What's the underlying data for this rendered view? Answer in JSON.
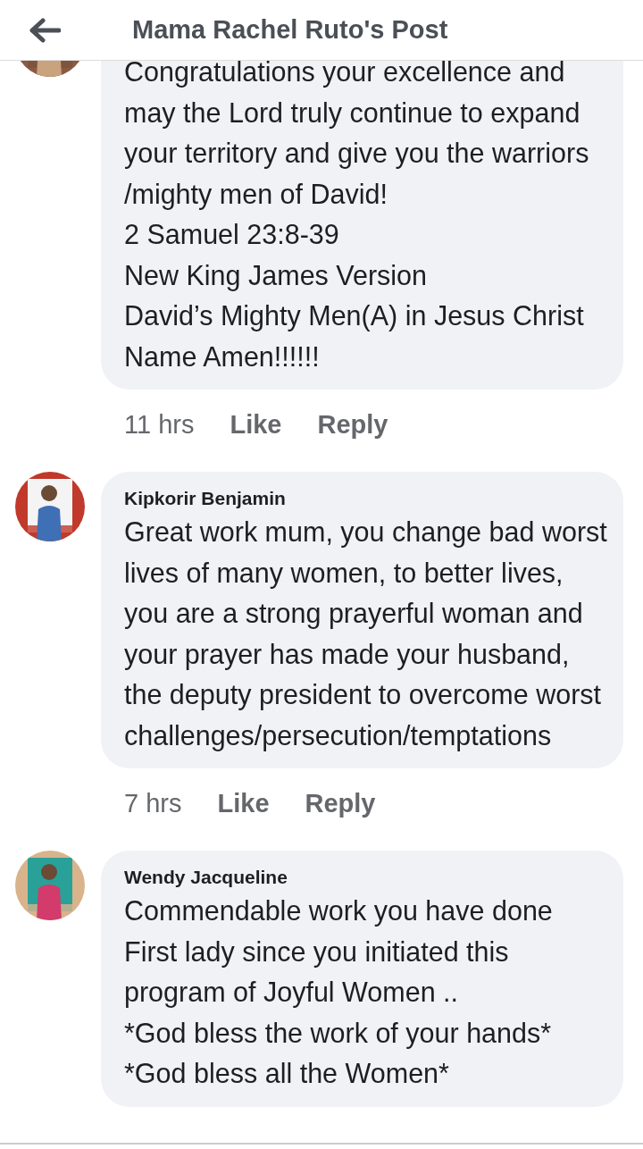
{
  "header": {
    "title": "Mama Rachel Ruto's Post"
  },
  "comments": [
    {
      "text": "Congratulations your excellence and may the Lord truly continue to expand your territory and give you the warriors /mighty men of David!\n2 Samuel 23:8-39\nNew King James Version\nDavid’s Mighty Men(A) in Jesus Christ Name Amen!!!!!!",
      "time": "11 hrs",
      "actions": [
        "Like",
        "Reply"
      ],
      "avatar": {
        "kind": "picture"
      }
    },
    {
      "author": "Kipkorir Benjamin",
      "text": "Great work mum, you change bad worst lives of many women, to better lives, you are a strong prayerful woman and your prayer has made your husband, the deputy president to overcome worst challenges/persecution/temptations",
      "time": "7 hrs",
      "actions": [
        "Like",
        "Reply"
      ],
      "avatar": {
        "kind": "picture"
      }
    },
    {
      "author": "Wendy Jacqueline",
      "text": "Commendable work you have done First lady since you initiated this program of Joyful Women ..\n*God bless the work of your hands*\n*God bless all the Women*",
      "avatar": {
        "kind": "picture"
      }
    }
  ]
}
